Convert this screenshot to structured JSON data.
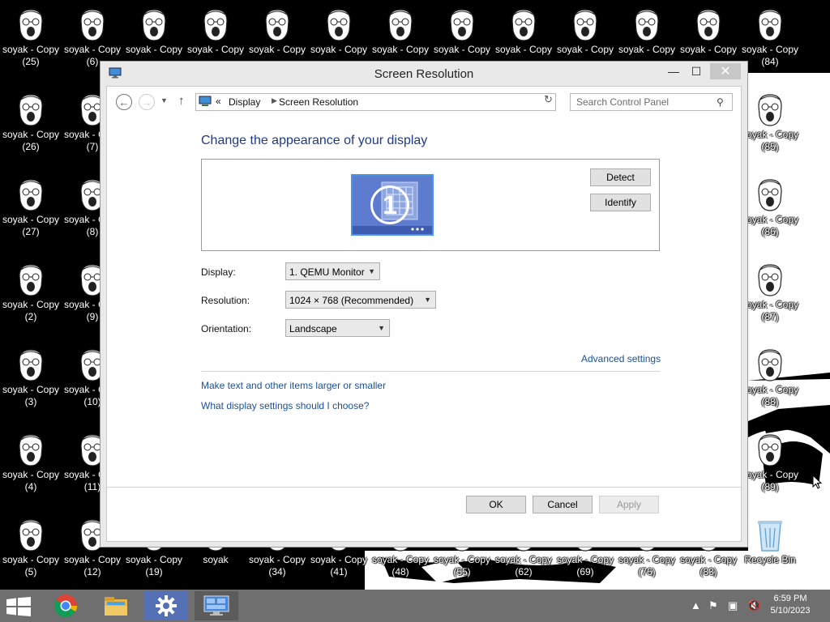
{
  "window": {
    "title": "Screen Resolution",
    "close_glyph": "✕"
  },
  "navbar": {
    "breadcrumb_chevron": "«",
    "breadcrumb": [
      "Display",
      "Screen Resolution"
    ],
    "search_placeholder": "Search Control Panel"
  },
  "content": {
    "heading": "Change the appearance of your display",
    "monitor_number": "1",
    "detect_label": "Detect",
    "identify_label": "Identify",
    "display_label": "Display:",
    "display_value": "1. QEMU Monitor",
    "resolution_label": "Resolution:",
    "resolution_value": "1024 × 768 (Recommended)",
    "orientation_label": "Orientation:",
    "orientation_value": "Landscape",
    "advanced_link": "Advanced settings",
    "larger_link": "Make text and other items larger or smaller",
    "choose_link": "What display settings should I choose?",
    "ok_label": "OK",
    "cancel_label": "Cancel",
    "apply_label": "Apply"
  },
  "desktop_icons": [
    "soyak - Copy\n(25)",
    "soyak - Copy\n(6)",
    "soyak - Copy",
    "soyak - Copy",
    "soyak - Copy",
    "soyak - Copy",
    "soyak - Copy",
    "soyak - Copy",
    "soyak - Copy",
    "soyak - Copy",
    "soyak - Copy",
    "soyak - Copy",
    "soyak - Copy\n(84)",
    "soyak - Copy\n(26)",
    "soyak - Copy\n(7)",
    "soyak - Copy\n(85)",
    "soyak - Copy\n(27)",
    "soyak - Copy\n(8)",
    "soyak - Copy\n(86)",
    "soyak - Copy\n(2)",
    "soyak - Copy\n(9)",
    "soyak - Copy\n(87)",
    "soyak - Copy\n(3)",
    "soyak - Copy\n(10)",
    "soyak - Copy\n(88)",
    "soyak - Copy\n(4)",
    "soyak - Copy\n(11)",
    "soyak - Copy\n(89)",
    "soyak - Copy\n(5)",
    "soyak - Copy\n(12)",
    "soyak - Copy\n(19)",
    "soyak",
    "soyak - Copy\n(34)",
    "soyak - Copy\n(41)",
    "soyak - Copy\n(48)",
    "soyak - Copy\n(55)",
    "soyak - Copy\n(62)",
    "soyak - Copy\n(69)",
    "soyak - Copy\n(76)",
    "soyak - Copy\n(83)",
    "Recycle Bin"
  ],
  "taskbar": {
    "apps": [
      "chrome-icon",
      "file-explorer-icon",
      "settings-icon",
      "display-icon"
    ],
    "tray_chevron": "▲",
    "time": "6:59 PM",
    "date": "5/10/2023"
  },
  "colors": {
    "accent_heading": "#1e3a8a",
    "link": "#1a4f99",
    "taskbar": "#6f6f6f"
  }
}
